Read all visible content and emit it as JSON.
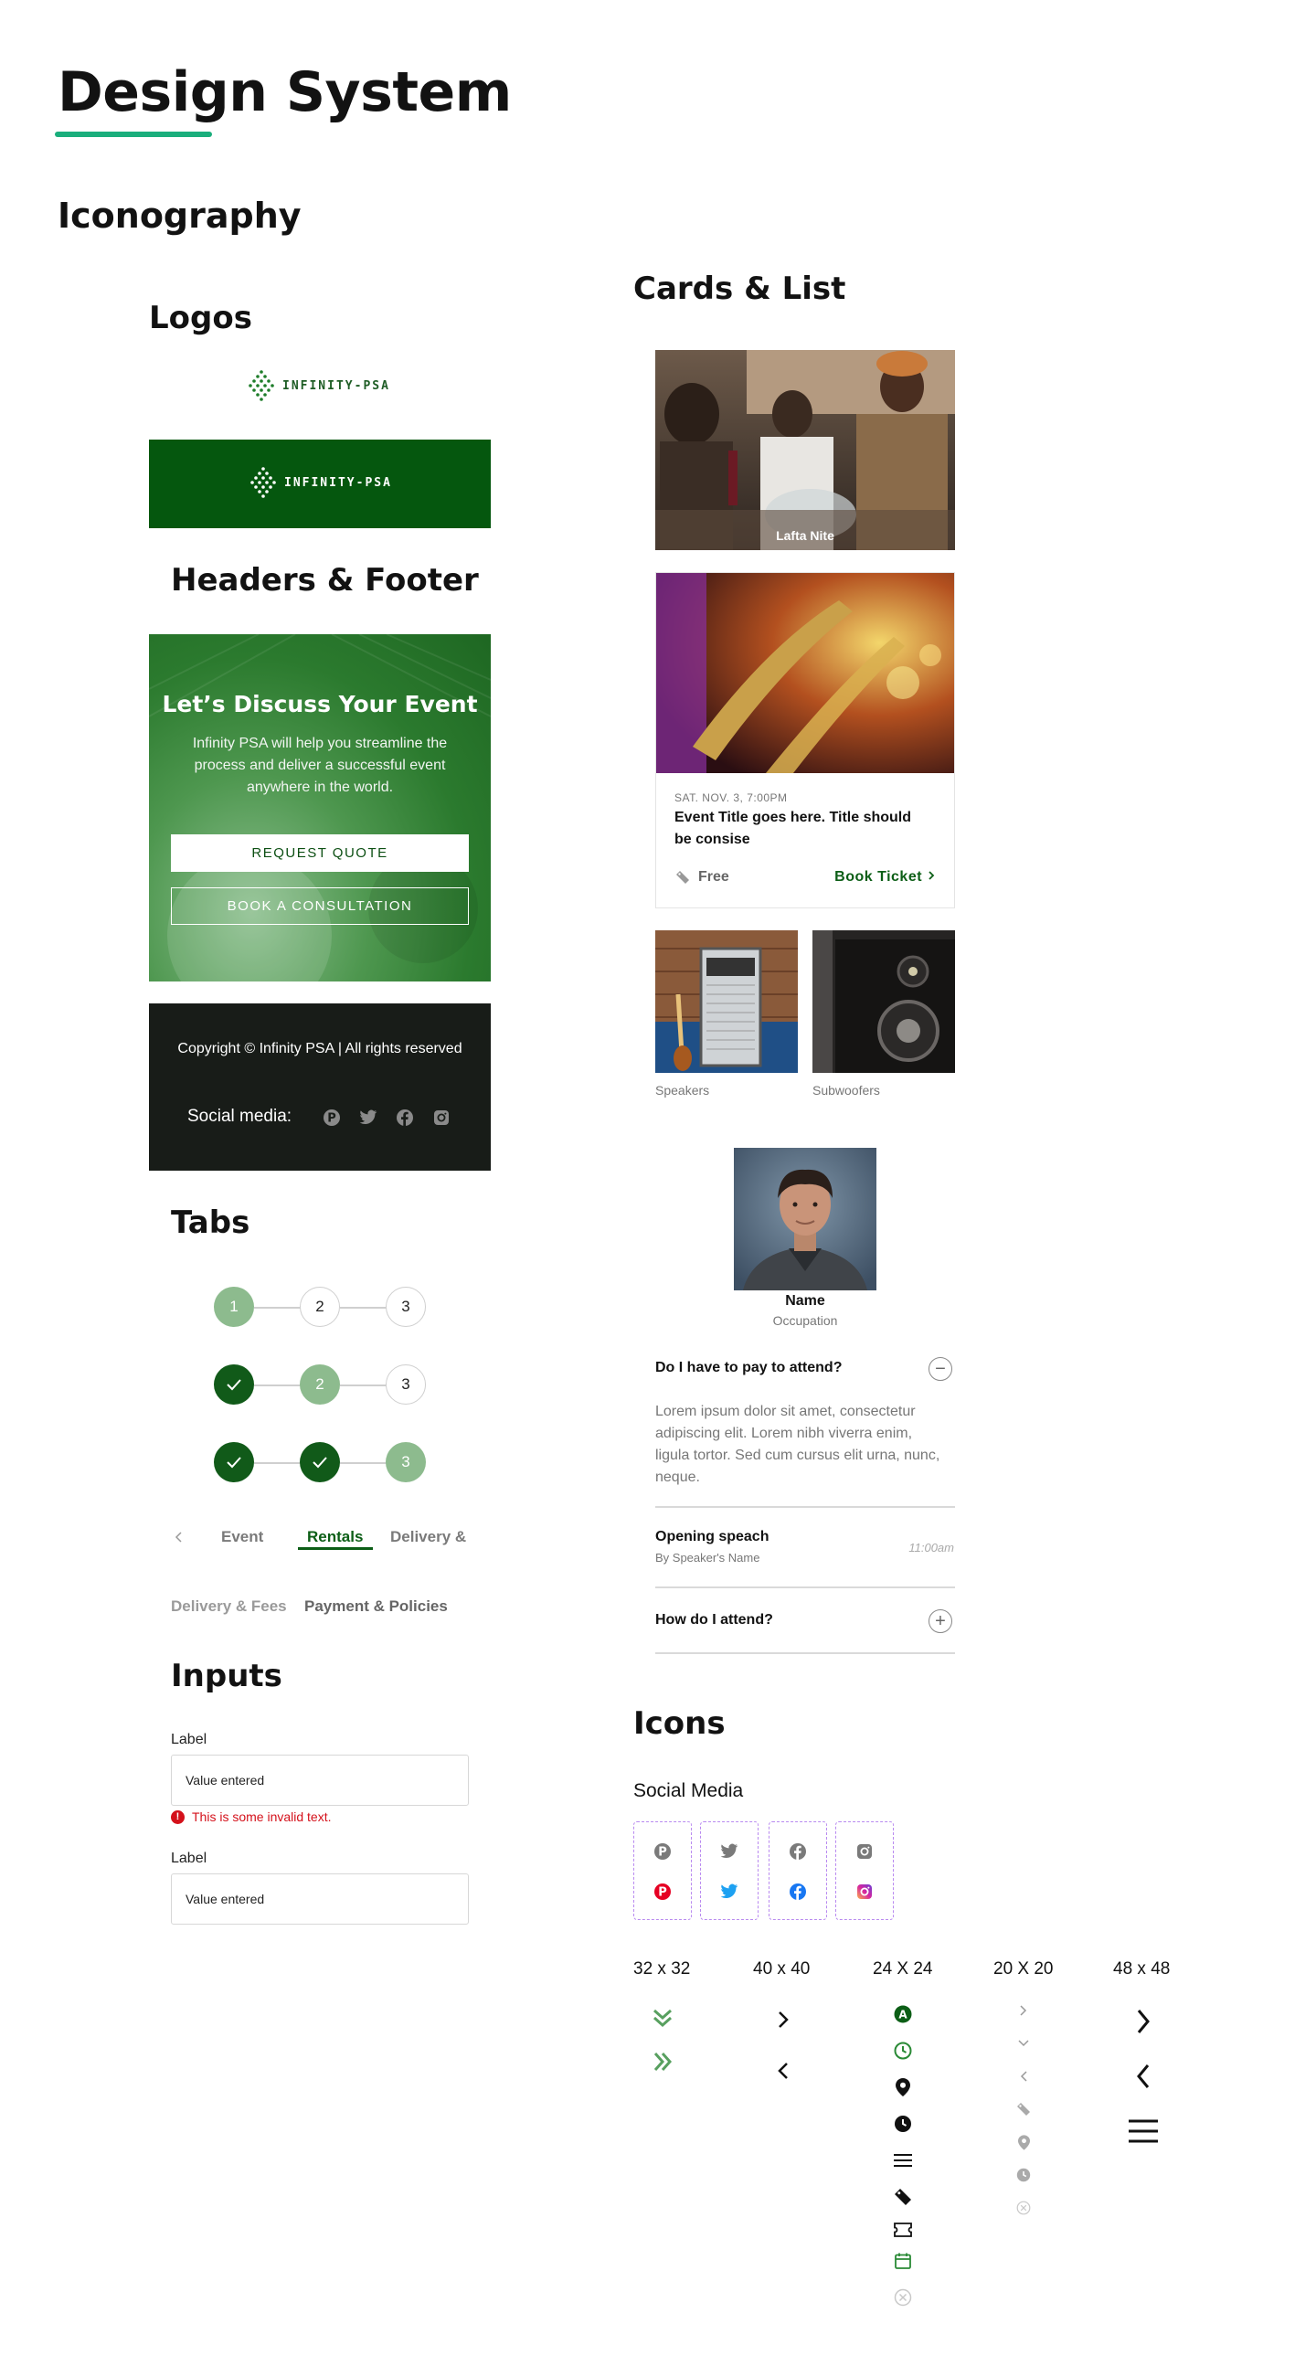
{
  "page": {
    "title": "Design System",
    "section": "Iconography"
  },
  "logos": {
    "heading": "Logos",
    "brand_text": "INFINITY-PSA"
  },
  "headers_footer": {
    "heading": "Headers & Footer",
    "banner_title": "Let’s Discuss Your Event",
    "banner_body": "Infinity PSA will help you streamline the process and deliver a successful event anywhere in the world.",
    "primary_button": "REQUEST QUOTE",
    "secondary_button": "BOOK A CONSULTATION",
    "footer_copy": "Copyright © Infinity PSA | All rights reserved",
    "footer_social_label": "Social media:"
  },
  "tabs": {
    "heading": "Tabs",
    "steps": [
      "1",
      "2",
      "3"
    ],
    "tab_labels": [
      "Event",
      "Rentals",
      "Delivery &"
    ],
    "tab_labels_row2": [
      "Delivery & Fees",
      "Payment & Policies"
    ],
    "selected_tab": "Rentals"
  },
  "inputs": {
    "heading": "Inputs",
    "field1_label": "Label",
    "field1_value": "Value entered",
    "field1_error": "This is some invalid text.",
    "field2_label": "Label",
    "field2_value": "Value entered"
  },
  "cards": {
    "heading": "Cards & List",
    "card1_caption": "Lafta Nite",
    "event_date": "SAT. NOV. 3, 7:00PM",
    "event_title": "Event Title goes here. Title should be consise",
    "event_price": "Free",
    "event_cta": "Book Ticket",
    "thumbs": [
      "Speakers",
      "Subwoofers"
    ],
    "person_name": "Name",
    "person_occupation": "Occupation",
    "faq": [
      {
        "question": "Do I have to pay to attend?",
        "answer": "Lorem ipsum dolor sit amet, consectetur adipiscing elit. Lorem nibh viverra enim, ligula tortor. Sed cum cursus elit urna, nunc, neque.",
        "expanded": true
      },
      {
        "question": "How do I attend?",
        "expanded": false
      }
    ],
    "agenda": {
      "title": "Opening speach",
      "speaker": "By Speaker's Name",
      "time": "11:00am"
    }
  },
  "icons": {
    "heading": "Icons",
    "social_label": "Social Media",
    "social": [
      "pinterest-icon",
      "twitter-icon",
      "facebook-icon",
      "instagram-icon"
    ],
    "brand_colors": {
      "pinterest": "#e60023",
      "twitter": "#1da1f2",
      "facebook": "#1877f2",
      "instagram": "#d6249f"
    },
    "sizes": [
      "32 x 32",
      "40 x 40",
      "24 X 24",
      "20 X 20",
      "48 x 48"
    ]
  },
  "colors": {
    "brand_green": "#05570e",
    "accent_teal": "#1aae7c",
    "footer_bg": "#181c18",
    "step_active": "#8dbb8e",
    "step_done": "#115a19"
  }
}
